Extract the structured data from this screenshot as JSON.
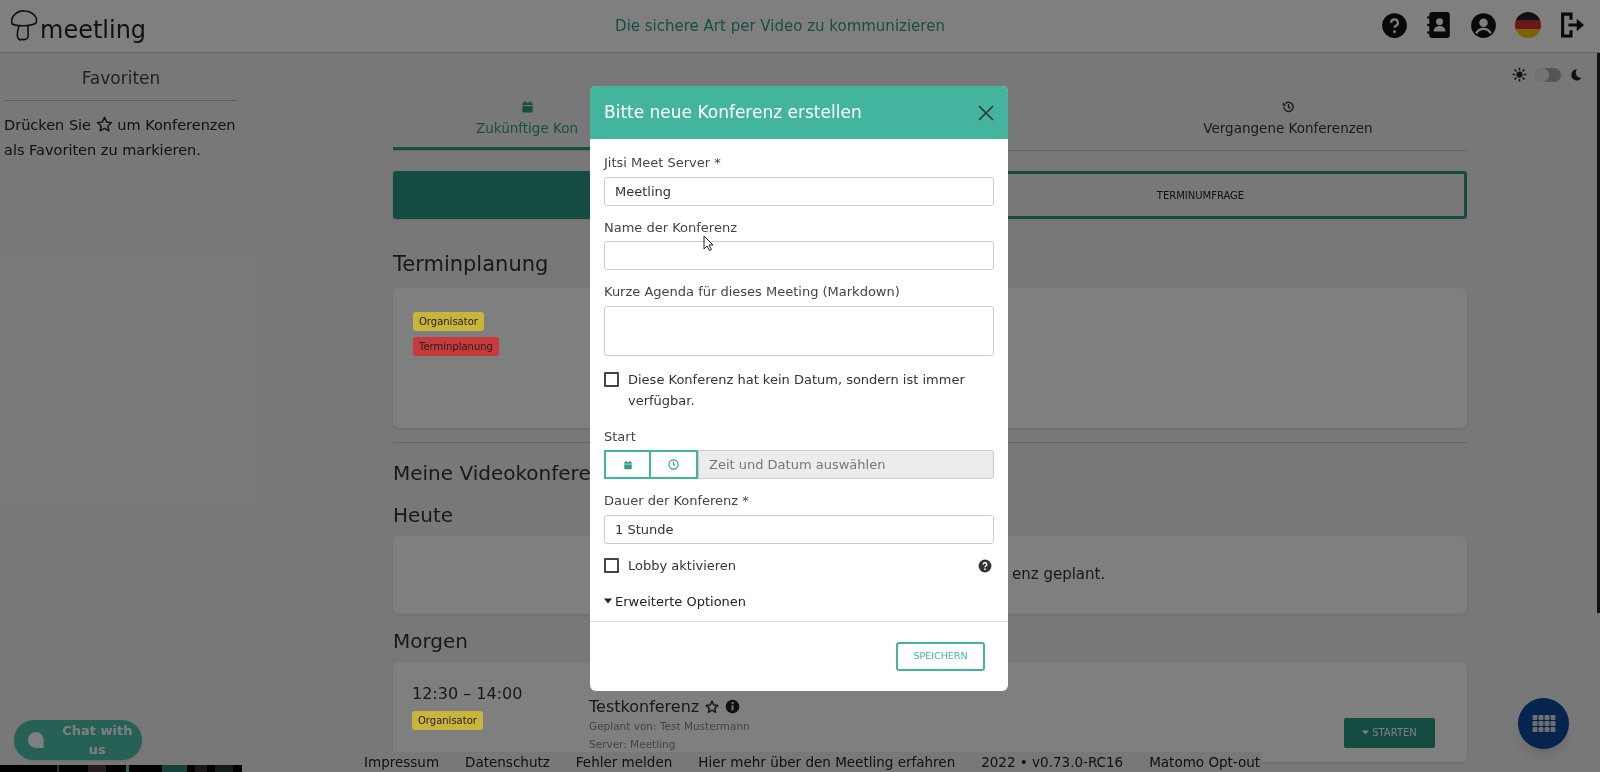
{
  "header": {
    "logo_text": "meetling",
    "tagline": "Die sichere Art per Video zu kommunizieren"
  },
  "sidebar": {
    "title": "Favoriten",
    "hint_before": "Drücken Sie",
    "hint_after": "um Konferenzen",
    "hint_line2": "als Favoriten zu markieren."
  },
  "theme_toggle": {
    "on": false
  },
  "tabs": [
    {
      "label": "Zukünftige Kon",
      "selected": true,
      "kind": "calendar"
    },
    {
      "label": "Vergangene Konferenzen",
      "selected": false,
      "kind": "history"
    }
  ],
  "actions": [
    {
      "kind": "filled"
    },
    {
      "kind": "outline",
      "label": "TERMINUMFRAGE"
    }
  ],
  "scheduling": {
    "title": "Terminplanung",
    "badges": [
      {
        "label": "Organisator",
        "color": "#c9b43c"
      },
      {
        "label": "Terminplanung",
        "color": "#c83a3a"
      }
    ]
  },
  "my_conferences": {
    "title": "Meine Videokonfere",
    "today": {
      "title": "Heute",
      "message": "enz geplant."
    },
    "tomorrow": {
      "title": "Morgen",
      "items": [
        {
          "time": "12:30 – 14:00",
          "badge": {
            "label": "Organisator",
            "color": "#c9b43c"
          },
          "title": "Testkonferenz",
          "planned_by": "Geplant von: Test Mustermann",
          "server": "Server: Meetling",
          "start_button": "STARTEN"
        }
      ]
    }
  },
  "footer": [
    "Impressum",
    "Datenschutz",
    "Fehler melden",
    "Hier mehr über den Meetling erfahren",
    "2022 • v0.73.0-RC16",
    "Matomo Opt-out"
  ],
  "chat_button": "Chat with us",
  "modal": {
    "title": "Bitte neue Konferenz erstellen",
    "fields": [
      {
        "kind": "text",
        "label": "Jitsi Meet Server *",
        "value": "Meetling"
      },
      {
        "kind": "text",
        "label": "Name der Konferenz"
      },
      {
        "kind": "textarea",
        "label": "Kurze Agenda für dieses Meeting (Markdown)"
      },
      {
        "kind": "checkbox",
        "label": "Diese Konferenz hat kein Datum, sondern ist immer verfügbar.",
        "checked": false
      },
      {
        "kind": "datetime",
        "label": "Start",
        "placeholder": "Zeit und Datum auswählen"
      },
      {
        "kind": "text",
        "label": "Dauer der Konferenz *",
        "value": "1 Stunde"
      },
      {
        "kind": "checkbox",
        "label": "Lobby aktivieren",
        "checked": false,
        "help": true
      },
      {
        "kind": "expander",
        "label": "Erweiterte Optionen",
        "expanded": false
      }
    ],
    "save_button": "SPEICHERN"
  }
}
